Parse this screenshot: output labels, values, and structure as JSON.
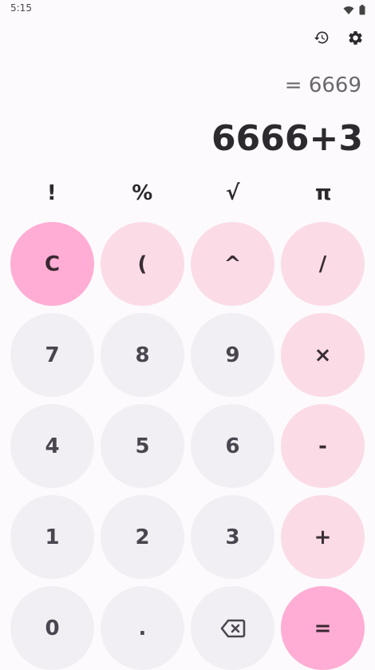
{
  "status_bar": {
    "time": "5:15",
    "icons": [
      "wifi-icon",
      "battery-icon"
    ]
  },
  "toolbar": {
    "icons": [
      "history-icon",
      "settings-icon"
    ]
  },
  "display": {
    "result": "= 6669",
    "expression": "6666+3"
  },
  "functions": [
    "!",
    "%",
    "√",
    "π"
  ],
  "keys": {
    "clear": "C",
    "paren": "(",
    "power": "^",
    "divide": "/",
    "seven": "7",
    "eight": "8",
    "nine": "9",
    "multiply": "×",
    "four": "4",
    "five": "5",
    "six": "6",
    "minus": "-",
    "one": "1",
    "two": "2",
    "three": "3",
    "plus": "+",
    "zero": "0",
    "dot": ".",
    "equals": "="
  },
  "colors": {
    "background": "#FCFAFC",
    "number_key": "#F2EFF4",
    "operator_key": "#FBDCE6",
    "accent_key": "#FFADD4",
    "text": "#2C2A2E"
  }
}
